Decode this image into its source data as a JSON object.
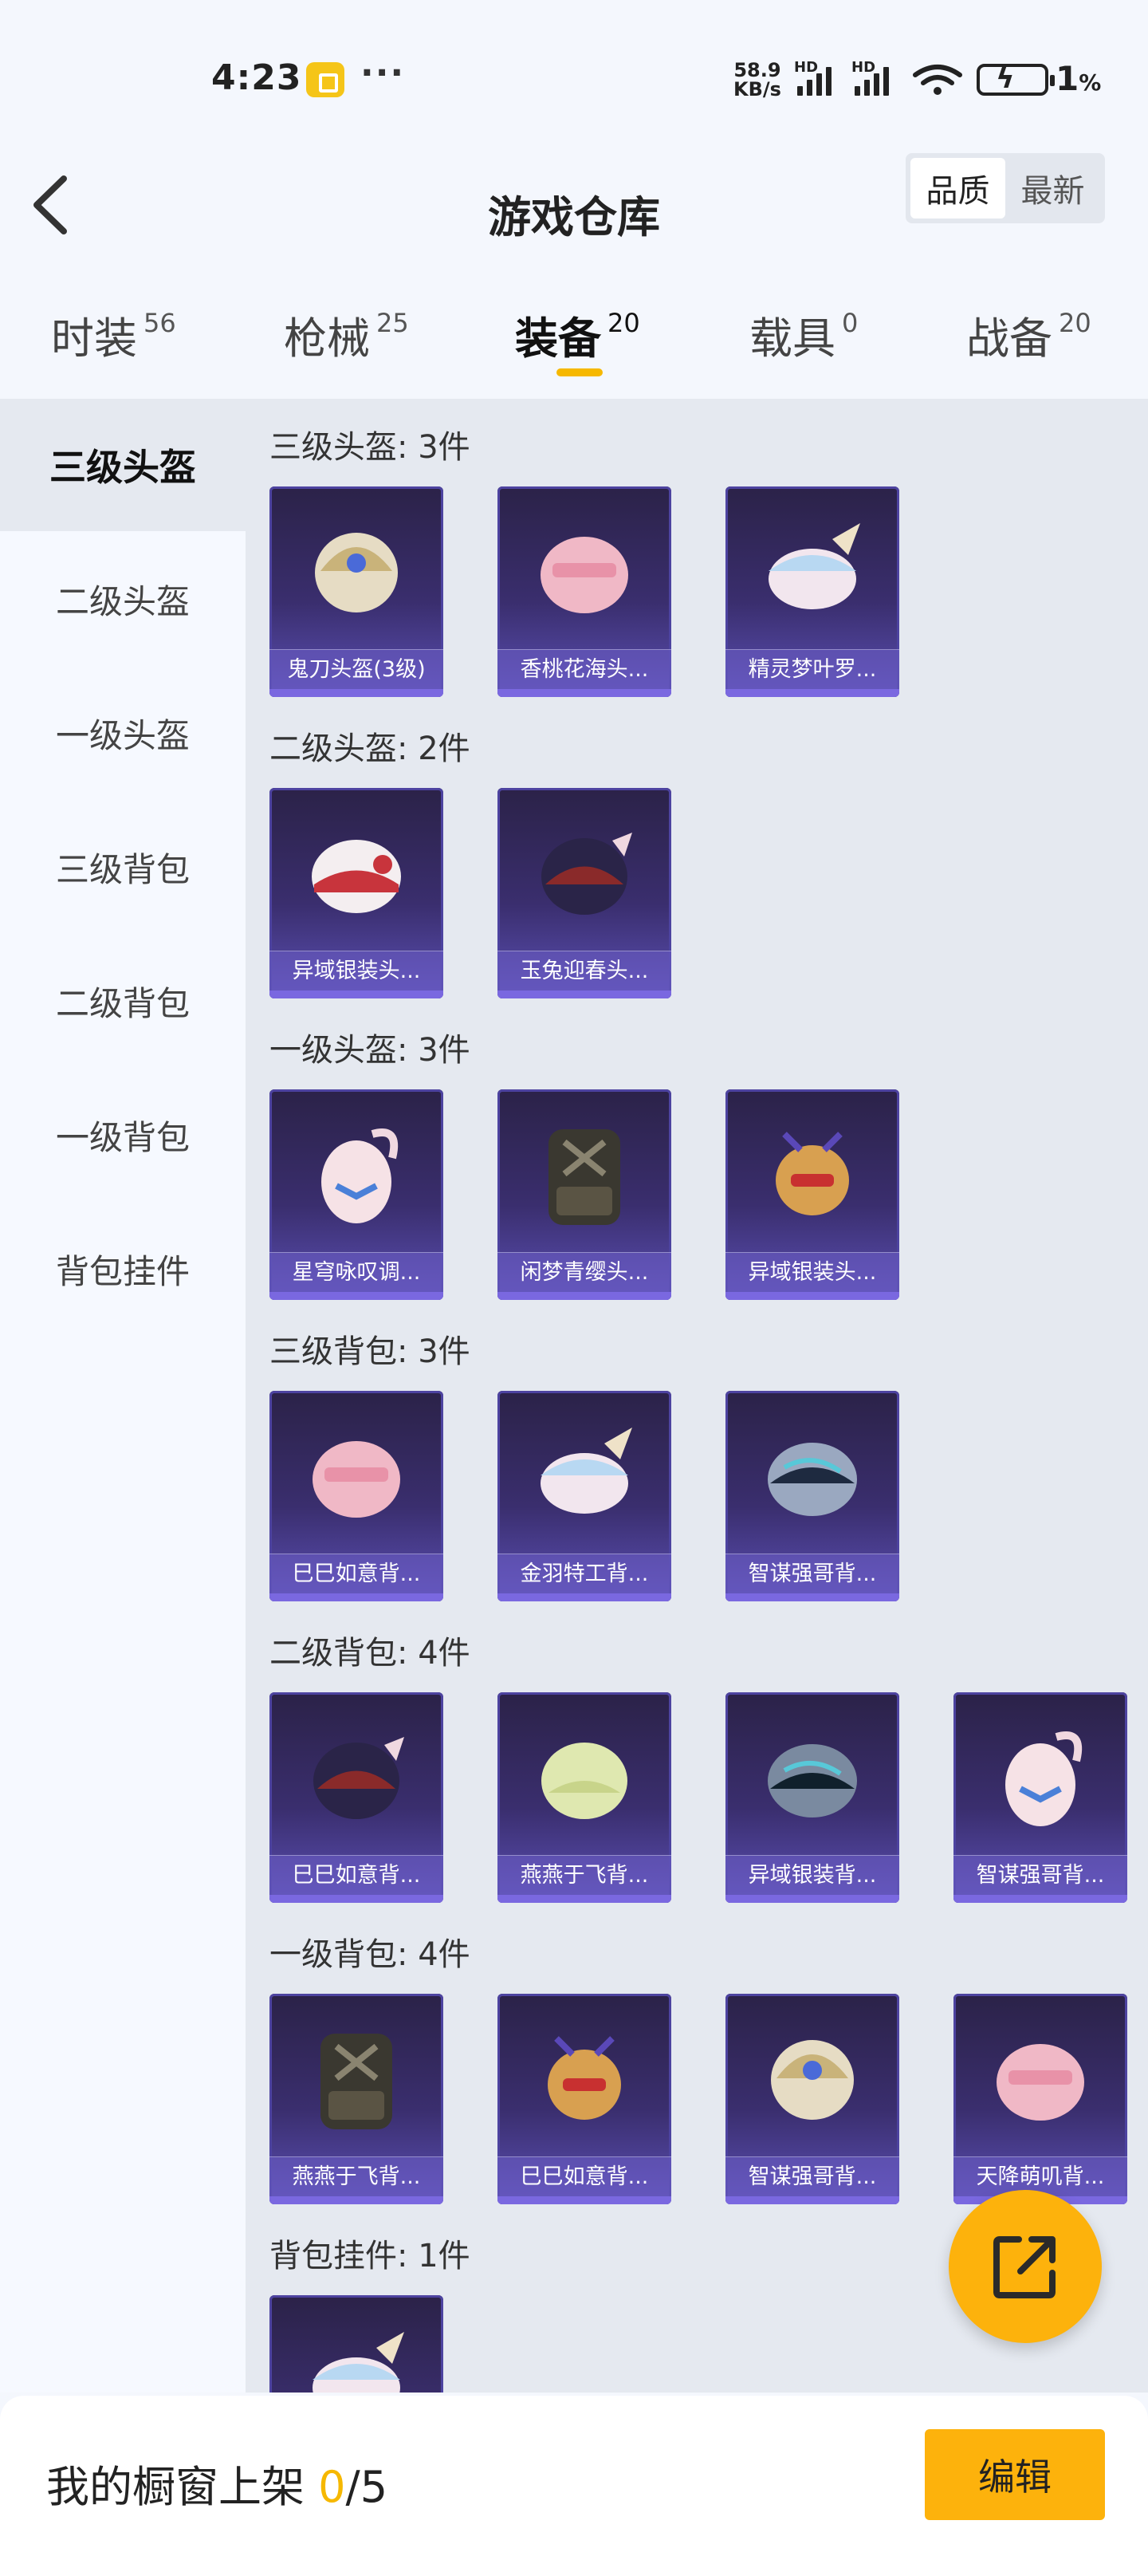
{
  "status_bar": {
    "time": "4:23",
    "net_speed_top": "58.9",
    "net_speed_unit": "KB/s",
    "signal1_tag": "HD",
    "signal2_tag": "HD",
    "battery_pct": "1",
    "battery_unit": "%"
  },
  "header": {
    "title": "游戏仓库",
    "sort_quality": "品质",
    "sort_latest": "最新"
  },
  "tabs": [
    {
      "label": "时装",
      "count": "56"
    },
    {
      "label": "枪械",
      "count": "25"
    },
    {
      "label": "装备",
      "count": "20"
    },
    {
      "label": "载具",
      "count": "0"
    },
    {
      "label": "战备",
      "count": "20"
    }
  ],
  "sidebar": {
    "items": [
      "三级头盔",
      "二级头盔",
      "一级头盔",
      "三级背包",
      "二级背包",
      "一级背包",
      "背包挂件"
    ]
  },
  "sections": [
    {
      "title": "三级头盔: 3件",
      "items": [
        "鬼刀头盔(3级)",
        "香桃花海头...",
        "精灵梦叶罗..."
      ]
    },
    {
      "title": "二级头盔: 2件",
      "items": [
        "异域银装头...",
        "玉兔迎春头..."
      ]
    },
    {
      "title": "一级头盔: 3件",
      "items": [
        "星穹咏叹调...",
        "闲梦青缨头...",
        "异域银装头..."
      ]
    },
    {
      "title": "三级背包: 3件",
      "items": [
        "巳巳如意背...",
        "金羽特工背...",
        "智谋强哥背..."
      ]
    },
    {
      "title": "二级背包: 4件",
      "items": [
        "巳巳如意背...",
        "燕燕于飞背...",
        "异域银装背...",
        "智谋强哥背..."
      ]
    },
    {
      "title": "一级背包: 4件",
      "items": [
        "燕燕于飞背...",
        "巳巳如意背...",
        "智谋强哥背...",
        "天降萌叽背..."
      ]
    },
    {
      "title": "背包挂件: 1件",
      "items": [
        ""
      ]
    }
  ],
  "footer": {
    "prefix": "我的橱窗上架 ",
    "count": "0",
    "total": "/5",
    "edit_label": "编辑"
  },
  "colors": {
    "accent": "#f6b800",
    "fab": "#fdb20c",
    "card_top": "#2b2248",
    "card_bottom": "#5b4fb4"
  }
}
